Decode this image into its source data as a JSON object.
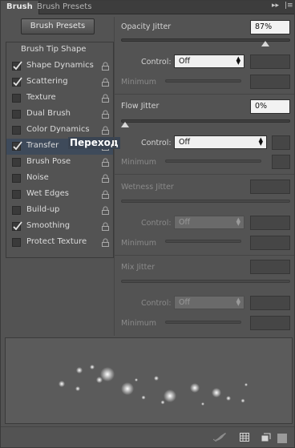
{
  "tabs": {
    "brush": "Brush",
    "brush_presets": "Brush Presets"
  },
  "toolbar_icons": [
    "expand-icon",
    "panel-menu-icon"
  ],
  "presets_button": "Brush Presets",
  "left_list": {
    "header": "Brush Tip Shape",
    "items": [
      {
        "label": "Shape Dynamics",
        "checked": true
      },
      {
        "label": "Scattering",
        "checked": true
      },
      {
        "label": "Texture",
        "checked": false
      },
      {
        "label": "Dual Brush",
        "checked": false
      },
      {
        "label": "Color Dynamics",
        "checked": false
      },
      {
        "label": "Transfer",
        "checked": true
      },
      {
        "label": "Brush Pose",
        "checked": false
      },
      {
        "label": "Noise",
        "checked": false
      },
      {
        "label": "Wet Edges",
        "checked": false
      },
      {
        "label": "Build-up",
        "checked": false
      },
      {
        "label": "Smoothing",
        "checked": true
      },
      {
        "label": "Protect Texture",
        "checked": false
      }
    ]
  },
  "tooltip_text": "Переход",
  "opacity": {
    "label": "Opacity Jitter",
    "value": "87%",
    "fraction": 0.87,
    "control_label": "Control:",
    "control_value": "Off",
    "minimum_label": "Minimum"
  },
  "flow": {
    "label": "Flow Jitter",
    "value": "0%",
    "fraction": 0.0,
    "control_label": "Control:",
    "control_value": "Off",
    "minimum_label": "Minimum"
  },
  "wetness": {
    "label": "Wetness Jitter",
    "control_label": "Control:",
    "control_value": "Off",
    "minimum_label": "Minimum"
  },
  "mix": {
    "label": "Mix Jitter",
    "control_label": "Control:",
    "control_value": "Off",
    "minimum_label": "Minimum"
  },
  "footer_icons": [
    "brush-toggle-icon",
    "grid-icon",
    "new-preset-icon"
  ]
}
